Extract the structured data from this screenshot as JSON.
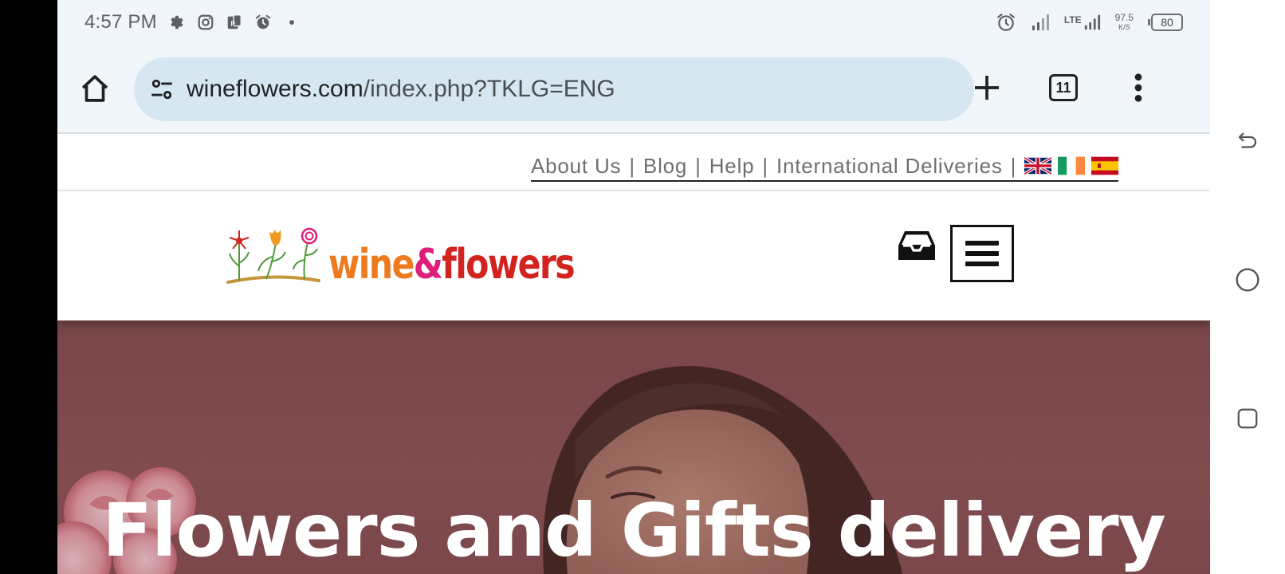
{
  "status_bar": {
    "time": "4:57 PM",
    "network_type": "LTE",
    "speed_value": "97.5",
    "speed_unit": "K/S",
    "battery": "80"
  },
  "browser": {
    "url_domain": "wineflowers.com",
    "url_path": "/index.php?TKLG=ENG",
    "tab_count": "11"
  },
  "top_links": {
    "about": "About Us",
    "blog": "Blog",
    "help": "Help",
    "international": "International Deliveries",
    "separator": "|"
  },
  "logo": {
    "word_1": "wine",
    "word_2": "&",
    "word_3": "flowers"
  },
  "hero": {
    "title": "Flowers and Gifts delivery"
  },
  "icons": {
    "status_left": [
      "settings-icon",
      "instagram-icon",
      "app-icon",
      "alarm-icon",
      "dot-icon"
    ],
    "status_right": [
      "alarm-icon",
      "signal-icon",
      "lte-signal-icon",
      "battery-icon"
    ],
    "toolbar": [
      "home-icon",
      "site-settings-icon",
      "new-tab-icon",
      "tab-switcher-icon",
      "more-menu-icon"
    ],
    "nav": [
      "back-icon",
      "home-circle-icon",
      "recents-icon"
    ]
  },
  "colors": {
    "status_bg": "#f1f6fa",
    "urlbar_bg": "#d6e7f1",
    "logo_orange": "#ee7a1e",
    "logo_pink": "#de1f7c",
    "logo_red": "#d3231f",
    "hero_bg": "#7d4c4f"
  }
}
